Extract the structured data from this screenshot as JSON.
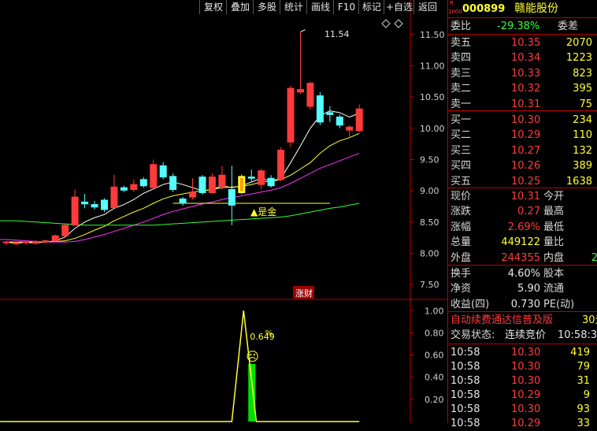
{
  "toolbar": {
    "buttons": [
      "复权",
      "叠加",
      "多股",
      "统计",
      "画线",
      "F10",
      "标记",
      "+自选",
      "返回"
    ]
  },
  "stock": {
    "code": "000899",
    "name": "赣能股份",
    "badge_top": "R",
    "badge_bottom": "1000"
  },
  "weibi": {
    "label": "委比",
    "value": "-29.38%",
    "diff_label": "委差"
  },
  "asks": [
    {
      "label": "卖五",
      "price": "10.35",
      "vol": "2070"
    },
    {
      "label": "卖四",
      "price": "10.34",
      "vol": "1223"
    },
    {
      "label": "卖三",
      "price": "10.33",
      "vol": "823"
    },
    {
      "label": "卖二",
      "price": "10.32",
      "vol": "395"
    },
    {
      "label": "卖一",
      "price": "10.31",
      "vol": "75"
    }
  ],
  "bids": [
    {
      "label": "买一",
      "price": "10.30",
      "vol": "234"
    },
    {
      "label": "买二",
      "price": "10.29",
      "vol": "110"
    },
    {
      "label": "买三",
      "price": "10.27",
      "vol": "132"
    },
    {
      "label": "买四",
      "price": "10.26",
      "vol": "389"
    },
    {
      "label": "买五",
      "price": "10.25",
      "vol": "1638"
    }
  ],
  "quote": [
    {
      "l1": "现价",
      "v1": "10.31",
      "c1": "red",
      "l2": "今开"
    },
    {
      "l1": "涨跌",
      "v1": "0.27",
      "c1": "red",
      "l2": "最高"
    },
    {
      "l1": "涨幅",
      "v1": "2.69%",
      "c1": "red",
      "l2": "最低"
    },
    {
      "l1": "总量",
      "v1": "449122",
      "c1": "yellow",
      "l2": "量比"
    },
    {
      "l1": "外盘",
      "v1": "244355",
      "c1": "red",
      "l2": "内盘",
      "v2": "2",
      "c2": "green"
    }
  ],
  "fundamentals": [
    {
      "l1": "换手",
      "v1": "4.60%",
      "l2": "股本"
    },
    {
      "l1": "净资",
      "v1": "5.90",
      "l2": "流通"
    },
    {
      "l1": "收益(四)",
      "v1": "0.730",
      "l2": "PE(动)"
    }
  ],
  "ad_text": "自动续费通达信普及版",
  "ad_tail": "30元",
  "trade_status": {
    "label": "交易状态:",
    "value": "连续竞价",
    "time": "10:58:3"
  },
  "ticks": [
    {
      "time": "10:58",
      "price": "10.30",
      "vol": "419",
      "side": "B"
    },
    {
      "time": "10:58",
      "price": "10.30",
      "vol": "79",
      "side": "S"
    },
    {
      "time": "10:58",
      "price": "10.30",
      "vol": "31",
      "side": "S"
    },
    {
      "time": "10:58",
      "price": "10.29",
      "vol": "9",
      "side": "S"
    },
    {
      "time": "10:58",
      "price": "10.30",
      "vol": "93",
      "side": "B"
    },
    {
      "time": "10:58",
      "price": "10.29",
      "vol": "33",
      "side": "S"
    }
  ],
  "chart_data": {
    "type": "candlestick",
    "y_ticks": [
      "11.50",
      "11.00",
      "10.50",
      "10.00",
      "9.50",
      "9.00",
      "8.50",
      "8.00",
      "7.50"
    ],
    "ylim": [
      7.3,
      11.8
    ],
    "high_marker": "11.54",
    "signal_label": "▲是金",
    "event_label": "涨财",
    "candles": [
      {
        "o": 8.17,
        "c": 8.18,
        "h": 8.2,
        "l": 8.13
      },
      {
        "o": 8.15,
        "c": 8.17,
        "h": 8.19,
        "l": 8.13
      },
      {
        "o": 8.17,
        "c": 8.18,
        "h": 8.2,
        "l": 8.14
      },
      {
        "o": 8.16,
        "c": 8.19,
        "h": 8.21,
        "l": 8.14
      },
      {
        "o": 8.18,
        "c": 8.2,
        "h": 8.22,
        "l": 8.16
      },
      {
        "o": 8.2,
        "c": 8.28,
        "h": 8.3,
        "l": 8.18
      },
      {
        "o": 8.28,
        "c": 8.45,
        "h": 8.48,
        "l": 8.26
      },
      {
        "o": 8.45,
        "c": 8.9,
        "h": 9.02,
        "l": 8.44
      },
      {
        "o": 8.82,
        "c": 8.79,
        "h": 8.95,
        "l": 8.72
      },
      {
        "o": 8.78,
        "c": 8.74,
        "h": 8.84,
        "l": 8.7
      },
      {
        "o": 8.85,
        "c": 8.7,
        "h": 8.88,
        "l": 8.66
      },
      {
        "o": 8.73,
        "c": 9.06,
        "h": 9.26,
        "l": 8.72
      },
      {
        "o": 9.05,
        "c": 9.01,
        "h": 9.08,
        "l": 8.98
      },
      {
        "o": 9.02,
        "c": 9.1,
        "h": 9.18,
        "l": 8.98
      },
      {
        "o": 9.18,
        "c": 9.08,
        "h": 9.22,
        "l": 9.05
      },
      {
        "o": 9.05,
        "c": 9.42,
        "h": 9.5,
        "l": 9.02
      },
      {
        "o": 9.4,
        "c": 9.22,
        "h": 9.46,
        "l": 9.18
      },
      {
        "o": 9.23,
        "c": 9.02,
        "h": 9.28,
        "l": 8.98
      },
      {
        "o": 8.87,
        "c": 8.8,
        "h": 8.9,
        "l": 8.76
      },
      {
        "o": 8.9,
        "c": 8.98,
        "h": 9.2,
        "l": 8.86
      },
      {
        "o": 9.22,
        "c": 8.97,
        "h": 9.25,
        "l": 8.94
      },
      {
        "o": 8.97,
        "c": 9.22,
        "h": 9.28,
        "l": 8.95
      },
      {
        "o": 9.07,
        "c": 9.25,
        "h": 9.4,
        "l": 9.02
      },
      {
        "o": 9.02,
        "c": 8.77,
        "h": 9.4,
        "l": 8.45
      },
      {
        "o": 8.97,
        "c": 9.23,
        "h": 9.26,
        "l": 8.95
      },
      {
        "o": 9.22,
        "c": 9.2,
        "h": 9.34,
        "l": 9.15
      },
      {
        "o": 9.1,
        "c": 9.32,
        "h": 9.35,
        "l": 9.02
      },
      {
        "o": 9.2,
        "c": 9.08,
        "h": 9.25,
        "l": 9.05
      },
      {
        "o": 9.18,
        "c": 9.65,
        "h": 9.7,
        "l": 9.15
      },
      {
        "o": 9.78,
        "c": 10.64,
        "h": 10.68,
        "l": 9.7
      },
      {
        "o": 10.58,
        "c": 10.62,
        "h": 11.54,
        "l": 10.55
      },
      {
        "o": 10.35,
        "c": 10.72,
        "h": 10.75,
        "l": 10.3
      },
      {
        "o": 10.52,
        "c": 10.1,
        "h": 10.58,
        "l": 10.05
      },
      {
        "o": 10.25,
        "c": 10.22,
        "h": 10.35,
        "l": 10.1
      },
      {
        "o": 10.18,
        "c": 10.05,
        "h": 10.22,
        "l": 10.0
      },
      {
        "o": 9.97,
        "c": 10.02,
        "h": 10.05,
        "l": 9.85
      },
      {
        "o": 9.96,
        "c": 10.31,
        "h": 10.38,
        "l": 9.94
      }
    ],
    "ma_short": [
      8.17,
      8.17,
      8.17,
      8.17,
      8.18,
      8.2,
      8.26,
      8.4,
      8.5,
      8.57,
      8.62,
      8.72,
      8.78,
      8.86,
      8.96,
      9.03,
      9.1,
      9.14,
      9.1,
      9.05,
      9.0,
      9.02,
      9.08,
      9.05,
      9.08,
      9.14,
      9.2,
      9.15,
      9.2,
      9.45,
      9.72,
      10.0,
      10.2,
      10.28,
      10.25,
      10.18,
      10.24
    ],
    "ma_mid": [
      8.18,
      8.18,
      8.18,
      8.18,
      8.18,
      8.19,
      8.2,
      8.24,
      8.3,
      8.37,
      8.43,
      8.52,
      8.59,
      8.66,
      8.72,
      8.8,
      8.87,
      8.92,
      8.95,
      8.98,
      9.0,
      9.02,
      9.05,
      9.06,
      9.07,
      9.1,
      9.14,
      9.15,
      9.18,
      9.25,
      9.35,
      9.45,
      9.6,
      9.72,
      9.8,
      9.85,
      9.92
    ],
    "ma_long1": [
      8.22,
      8.21,
      8.2,
      8.19,
      8.18,
      8.18,
      8.18,
      8.19,
      8.22,
      8.26,
      8.3,
      8.35,
      8.4,
      8.45,
      8.5,
      8.56,
      8.62,
      8.67,
      8.71,
      8.75,
      8.79,
      8.82,
      8.86,
      8.89,
      8.92,
      8.95,
      8.98,
      9.01,
      9.05,
      9.12,
      9.2,
      9.28,
      9.36,
      9.42,
      9.48,
      9.54,
      9.6
    ],
    "ma_long2": [
      8.52,
      8.52,
      8.51,
      8.5,
      8.49,
      8.48,
      8.47,
      8.46,
      8.45,
      8.45,
      8.45,
      8.45,
      8.45,
      8.45,
      8.45,
      8.45,
      8.46,
      8.47,
      8.48,
      8.49,
      8.5,
      8.51,
      8.52,
      8.53,
      8.54,
      8.55,
      8.56,
      8.57,
      8.58,
      8.6,
      8.63,
      8.66,
      8.69,
      8.72,
      8.74,
      8.77,
      8.8
    ],
    "support_level": 8.8,
    "indicator": {
      "y_ticks": [
        "1.00",
        "0.80",
        "0.60",
        "0.40",
        "0.20"
      ],
      "ylim": [
        0,
        1.08
      ],
      "line": [
        {
          "i": 0,
          "v": 0
        },
        {
          "i": 23,
          "v": 0
        },
        {
          "i": 24.2,
          "v": 1.0
        },
        {
          "i": 25.5,
          "v": 0
        },
        {
          "i": 36,
          "v": 0
        }
      ],
      "bar": {
        "i": 25,
        "v": 0.52
      },
      "label": "0.649",
      "label_suffix": "%",
      "face": "☹"
    }
  }
}
